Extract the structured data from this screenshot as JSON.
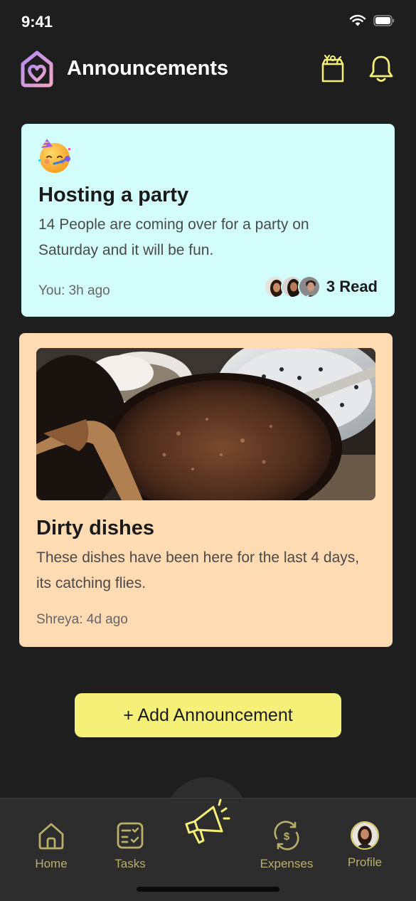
{
  "status_bar": {
    "time": "9:41"
  },
  "header": {
    "title": "Announcements"
  },
  "announcements": [
    {
      "emoji_icon": "partying-face-emoji",
      "title": "Hosting a party",
      "body": "14 People are coming over for a party on Saturday and it will be fun.",
      "meta": "You: 3h ago",
      "read_count": "3 Read",
      "background": "#d3fdfb"
    },
    {
      "image": "dirty-dishes-photo",
      "title": "Dirty dishes",
      "body": "These dishes have been here for the last 4 days, its catching flies.",
      "meta": "Shreya: 4d ago",
      "background": "#ffdbb3"
    }
  ],
  "add_button": {
    "label": "+ Add Announcement"
  },
  "tabbar": {
    "items": [
      {
        "label": "Home",
        "icon": "home-icon"
      },
      {
        "label": "Tasks",
        "icon": "tasks-icon"
      },
      {
        "label": "",
        "icon": "megaphone-icon"
      },
      {
        "label": "Expenses",
        "icon": "expenses-icon"
      },
      {
        "label": "Profile",
        "icon": "avatar"
      }
    ]
  },
  "colors": {
    "background": "#1f1e1f",
    "accent": "#f5f178",
    "tab_label": "#b8b06a",
    "party_card": "#d3fdfb",
    "dishes_card": "#ffdbb3"
  }
}
